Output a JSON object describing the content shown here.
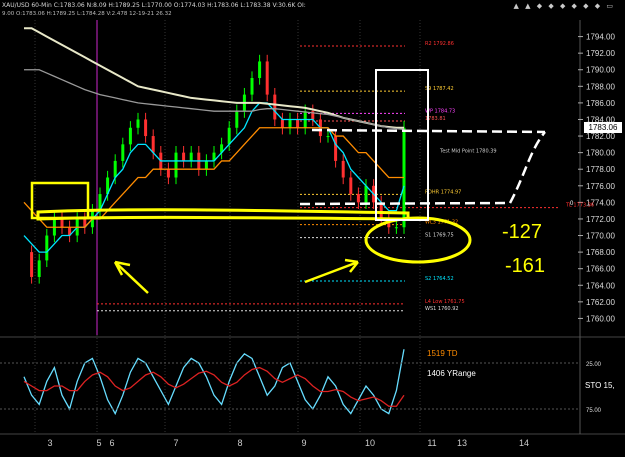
{
  "header": {
    "symbol_line": "XAU/USD 60-Min C:1783.06 N:8.09 H:1789.25 L:1770.00 O:1774.03 H:1783.06 L:1783.38 V:30.6K OI:",
    "sub_line": "9.00 O:1783.06 H:1789.25 L:1784.28 V:2.478 12-19-21 26.32",
    "icons": "▲ ▲ ◆ ◆ ◆ ◆ ◆ ◆ ▭"
  },
  "chart_data": [
    {
      "type": "line",
      "title": "XAU/USD 60-Min",
      "ylim": [
        1758,
        1796
      ],
      "y_ticks": [
        "1794.00",
        "1792.00",
        "1790.00",
        "1788.00",
        "1786.00",
        "1784.00",
        "1782.00",
        "1780.00",
        "1778.00",
        "1776.00",
        "1774.00",
        "1772.00",
        "1770.00",
        "1768.00",
        "1766.00",
        "1764.00",
        "1762.00",
        "1760.00"
      ],
      "current_price": "1783.06",
      "x_ticks": [
        "3",
        "5",
        "6",
        "7",
        "8",
        "9",
        "10",
        "11",
        "13",
        "14"
      ],
      "series": [
        {
          "name": "Close",
          "color": "#00ff00",
          "values": [
            1768,
            1765,
            1767,
            1770,
            1772,
            1771,
            1770,
            1772,
            1771,
            1773,
            1775,
            1777,
            1779,
            1781,
            1783,
            1784,
            1782,
            1780,
            1778,
            1777,
            1780,
            1779,
            1780,
            1778,
            1779,
            1780,
            1781,
            1783,
            1785,
            1787,
            1789,
            1791,
            1787,
            1784,
            1783,
            1784,
            1783,
            1785,
            1784,
            1782,
            1782,
            1779,
            1777,
            1775,
            1774,
            1776,
            1774,
            1772,
            1771,
            1771,
            1783
          ]
        },
        {
          "color": "#00e5ff",
          "values": [
            1770,
            1769,
            1768,
            1768,
            1769,
            1770,
            1770,
            1771,
            1771,
            1772,
            1773,
            1775,
            1777,
            1778,
            1780,
            1781,
            1781,
            1780,
            1779,
            1779,
            1779,
            1779,
            1779,
            1779,
            1779,
            1779,
            1780,
            1781,
            1782,
            1783,
            1785,
            1786,
            1786,
            1785,
            1784,
            1784,
            1784,
            1784,
            1784,
            1783,
            1783,
            1781,
            1780,
            1778,
            1777,
            1776,
            1775,
            1774,
            1773,
            1773,
            1776
          ]
        },
        {
          "color": "#ff8c00",
          "values": [
            1774,
            1773,
            1772,
            1771,
            1771,
            1771,
            1771,
            1771,
            1771,
            1772,
            1772,
            1773,
            1774,
            1775,
            1776,
            1777,
            1777,
            1778,
            1778,
            1778,
            1778,
            1778,
            1778,
            1778,
            1778,
            1778,
            1779,
            1779,
            1780,
            1781,
            1782,
            1783,
            1783,
            1783,
            1783,
            1783,
            1783,
            1783,
            1783,
            1783,
            1783,
            1782,
            1782,
            1781,
            1780,
            1780,
            1779,
            1778,
            1777,
            1777,
            1777
          ]
        },
        {
          "color": "#e8e8c8",
          "values": [
            1795,
            1795,
            1794.5,
            1794,
            1793.5,
            1793,
            1792.5,
            1792,
            1791.5,
            1791,
            1790.5,
            1790,
            1789.5,
            1789,
            1788.5,
            1788,
            1787.8,
            1787.6,
            1787.4,
            1787.2,
            1787,
            1786.8,
            1786.6,
            1786.5,
            1786.4,
            1786.3,
            1786.2,
            1786.1,
            1786,
            1786,
            1786,
            1786,
            1785.9,
            1785.8,
            1785.7,
            1785.6,
            1785.5,
            1785.4,
            1785.2,
            1785,
            1784.8,
            1784.5,
            1784.2,
            1784,
            1783.8,
            1783.6,
            1783.4,
            1783.2,
            1783.1,
            1783,
            1783
          ]
        },
        {
          "color": "#9a9a9a",
          "values": [
            1790,
            1790,
            1790,
            1789.6,
            1789.2,
            1788.8,
            1788.4,
            1788,
            1787.6,
            1787.3,
            1787,
            1786.8,
            1786.6,
            1786.4,
            1786.2,
            1786,
            1785.9,
            1785.8,
            1785.7,
            1785.6,
            1785.5,
            1785.4,
            1785.3,
            1785.2,
            1785.1,
            1785,
            1785,
            1785,
            1785,
            1785,
            1785,
            1785.2,
            1785.3,
            1785.3,
            1785.2,
            1785.1,
            1785,
            1784.9,
            1784.8,
            1784.7,
            1784.6,
            1784.4,
            1784.2,
            1784,
            1783.8,
            1783.6,
            1783.4,
            1783.2,
            1783,
            1782.9,
            1782.8
          ]
        }
      ],
      "levels": [
        {
          "label": "R2 1792.86",
          "value": 1792.86,
          "color": "#ff3030"
        },
        {
          "label": "S9 1787.42",
          "value": 1787.42,
          "color": "#ffcc33"
        },
        {
          "label": "WP 1784.73",
          "value": 1784.73,
          "color": "#ff44ff"
        },
        {
          "label": "1783.81",
          "value": 1783.81,
          "color": "#ff5555"
        },
        {
          "label": "Test Mid Point 1780.39",
          "value": 1780.39,
          "color": "#cccccc"
        },
        {
          "label": "PDHR 1774.97",
          "value": 1774.97,
          "color": "#ffcc33"
        },
        {
          "label": "TL 1773.36",
          "value": 1773.36,
          "color": "#ff3030"
        },
        {
          "label": "WL3 1771.32",
          "value": 1771.32,
          "color": "#ff8c00"
        },
        {
          "label": "S1 1769.75",
          "value": 1769.75,
          "color": "#dddddd"
        },
        {
          "label": "S2 1764.52",
          "value": 1764.52,
          "color": "#00e5ff"
        },
        {
          "label": "L4 Low 1761.75",
          "value": 1761.75,
          "color": "#ff3030"
        },
        {
          "label": "WS1 1760.92",
          "value": 1760.92,
          "color": "#dddddd"
        }
      ],
      "annotations": [
        "-127",
        "-161",
        "0"
      ]
    },
    {
      "type": "line",
      "title": "STO",
      "labels": [
        "1519 TD",
        "1406 YRange",
        "STO 15,"
      ],
      "y_ticks": [
        "25.00",
        "75.00"
      ],
      "series": [
        {
          "color": "#66ddff",
          "values": [
            60,
            40,
            30,
            55,
            70,
            40,
            25,
            55,
            75,
            80,
            60,
            35,
            20,
            40,
            65,
            80,
            75,
            60,
            45,
            30,
            50,
            70,
            80,
            75,
            60,
            40,
            30,
            55,
            75,
            85,
            80,
            60,
            40,
            50,
            70,
            75,
            55,
            35,
            25,
            40,
            60,
            50,
            30,
            20,
            35,
            50,
            40,
            25,
            20,
            45,
            90
          ]
        },
        {
          "color": "#dd2222",
          "values": [
            55,
            50,
            45,
            45,
            50,
            50,
            45,
            45,
            55,
            62,
            65,
            60,
            50,
            45,
            48,
            55,
            62,
            65,
            60,
            52,
            48,
            52,
            58,
            64,
            66,
            62,
            54,
            50,
            54,
            62,
            68,
            70,
            66,
            58,
            54,
            58,
            62,
            58,
            50,
            44,
            44,
            46,
            44,
            38,
            34,
            36,
            38,
            34,
            28,
            28,
            40
          ]
        }
      ]
    }
  ]
}
